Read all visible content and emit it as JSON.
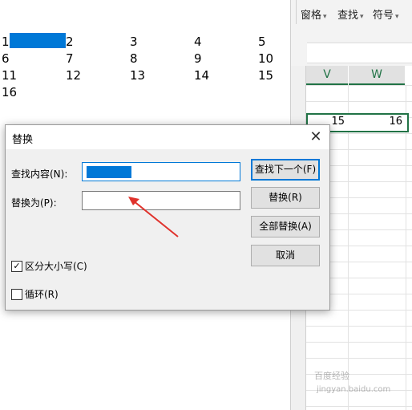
{
  "document": {
    "numbers": [
      "1",
      "2",
      "3",
      "4",
      "5",
      "6",
      "7",
      "8",
      "9",
      "10",
      "11",
      "12",
      "13",
      "14",
      "15",
      "16"
    ]
  },
  "ribbon": {
    "items": [
      {
        "label": "窗格"
      },
      {
        "label": "查找"
      },
      {
        "label": "符号"
      }
    ]
  },
  "sheet": {
    "columns": [
      "V",
      "W"
    ],
    "cells": [
      {
        "col": "V",
        "value": "15"
      },
      {
        "col": "W",
        "value": "16"
      }
    ]
  },
  "dialog": {
    "title": "替换",
    "find_label": "查找内容(N):",
    "replace_label": "替换为(P):",
    "find_value": "",
    "replace_value": "",
    "match_case_label": "区分大小写(C)",
    "match_case_checked": true,
    "wrap_label": "循环(R)",
    "wrap_checked": false,
    "buttons": {
      "find_next": "查找下一个(F)",
      "replace": "替换(R)",
      "replace_all": "全部替换(A)",
      "cancel": "取消"
    },
    "close_glyph": "✕",
    "accent_color": "#0078d7"
  },
  "watermark": {
    "line1": "百度经验",
    "line2": "jingyan.baidu.com"
  }
}
